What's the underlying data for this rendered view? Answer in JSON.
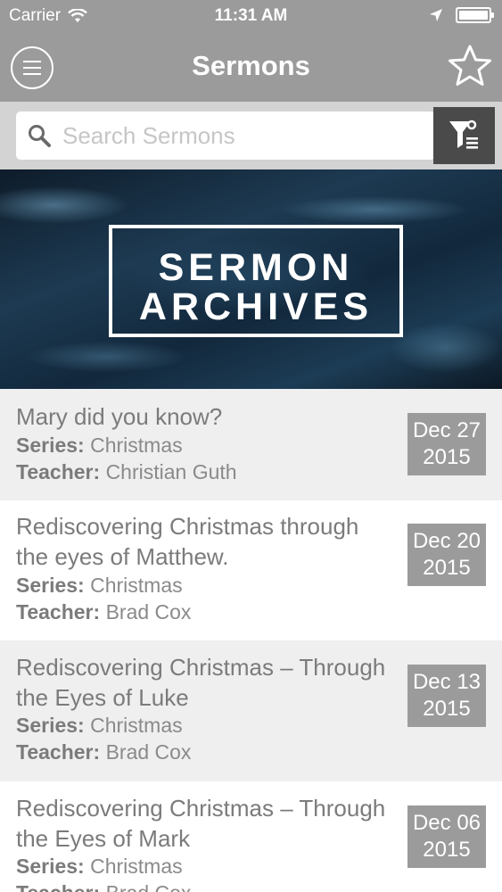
{
  "status_bar": {
    "carrier": "Carrier",
    "time": "11:31 AM"
  },
  "nav": {
    "title": "Sermons",
    "menu_icon": "hamburger-menu-icon",
    "favorites_icon": "star-outline-icon"
  },
  "search": {
    "placeholder": "Search Sermons",
    "value": "",
    "filter_icon": "filter-list-icon"
  },
  "banner": {
    "line1": "SERMON",
    "line2": "ARCHIVES"
  },
  "labels": {
    "series": "Series:",
    "teacher": "Teacher:"
  },
  "sermons": [
    {
      "title": "Mary did you know?",
      "series": "Christmas",
      "teacher": "Christian Guth",
      "date_month_day": "Dec 27",
      "date_year": "2015"
    },
    {
      "title": "Rediscovering Christmas through the eyes of Matthew.",
      "series": "Christmas",
      "teacher": "Brad Cox",
      "date_month_day": "Dec 20",
      "date_year": "2015"
    },
    {
      "title": "Rediscovering Christmas – Through the Eyes of Luke",
      "series": "Christmas",
      "teacher": "Brad Cox",
      "date_month_day": "Dec 13",
      "date_year": "2015"
    },
    {
      "title": "Rediscovering Christmas – Through the Eyes of Mark",
      "series": "Christmas",
      "teacher": "Brad Cox",
      "date_month_day": "Dec 06",
      "date_year": "2015"
    }
  ],
  "colors": {
    "header_gray": "#9b9b9b",
    "search_bg": "#d3d3d3",
    "filter_button": "#4a4a4a",
    "row_alt": "#efefef"
  }
}
